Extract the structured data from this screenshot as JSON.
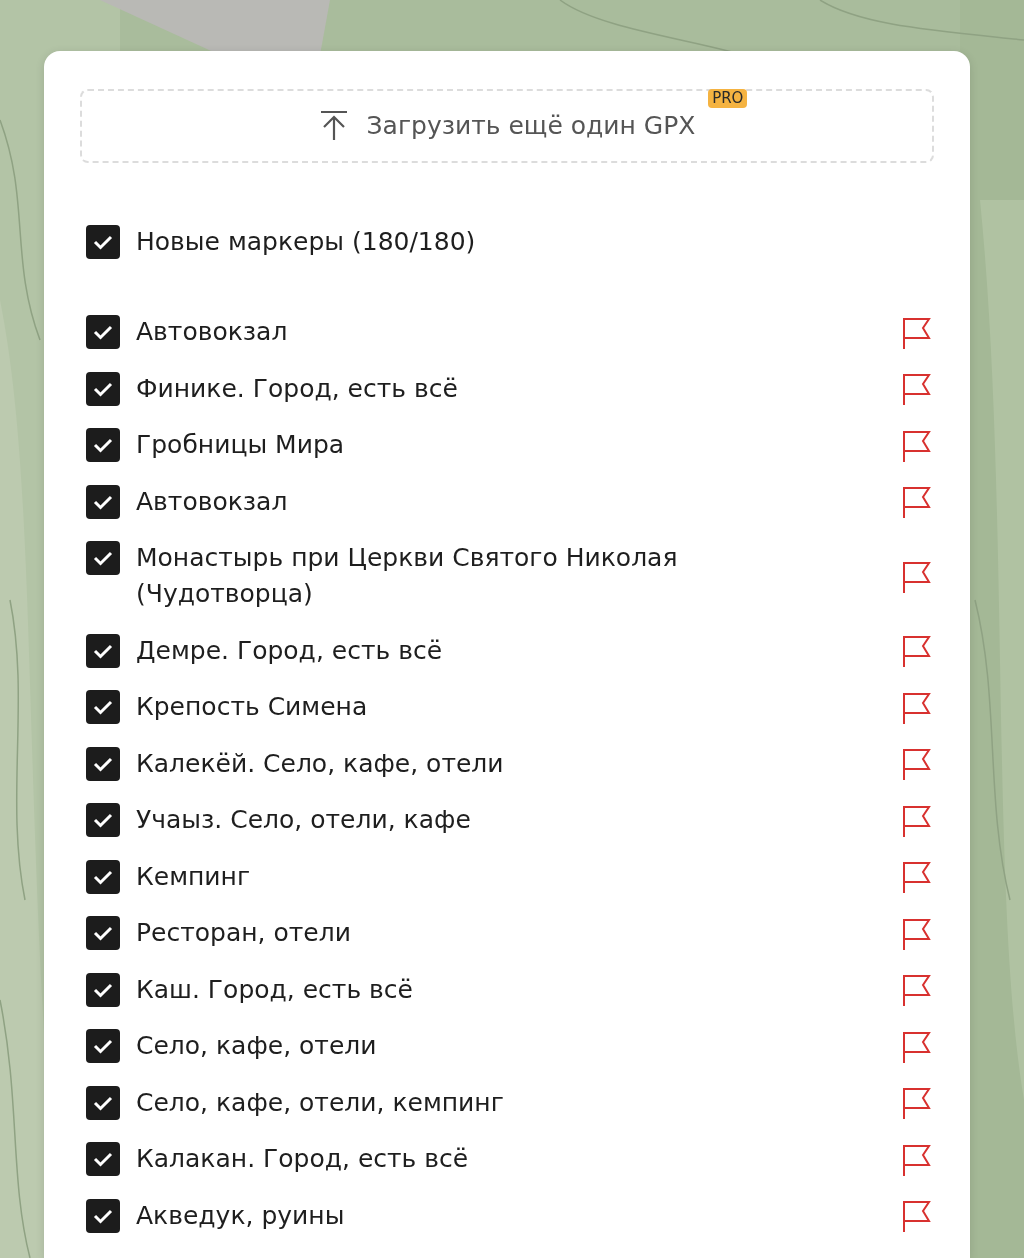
{
  "upload": {
    "label": "Загрузить ещё один GPX",
    "badge": "PRO"
  },
  "header": {
    "label": "Новые маркеры (180/180)",
    "checked": true
  },
  "markers": [
    {
      "label": "Автовокзал",
      "checked": true
    },
    {
      "label": "Финике. Город, есть всё",
      "checked": true
    },
    {
      "label": "Гробницы Мира",
      "checked": true
    },
    {
      "label": "Автовокзал",
      "checked": true
    },
    {
      "label": "Монастырь при Церкви Святого Николая (Чудотворца)",
      "checked": true
    },
    {
      "label": "Демре. Город, есть всё",
      "checked": true
    },
    {
      "label": "Крепость Симена",
      "checked": true
    },
    {
      "label": "Калекёй. Село, кафе, отели",
      "checked": true
    },
    {
      "label": "Учаыз. Село, отели, кафе",
      "checked": true
    },
    {
      "label": "Кемпинг",
      "checked": true
    },
    {
      "label": "Ресторан, отели",
      "checked": true
    },
    {
      "label": "Каш. Город, есть всё",
      "checked": true
    },
    {
      "label": "Село, кафе, отели",
      "checked": true
    },
    {
      "label": "Село, кафе, отели, кемпинг",
      "checked": true
    },
    {
      "label": "Калакан. Город, есть всё",
      "checked": true
    },
    {
      "label": "Акведук, руины",
      "checked": true
    }
  ]
}
